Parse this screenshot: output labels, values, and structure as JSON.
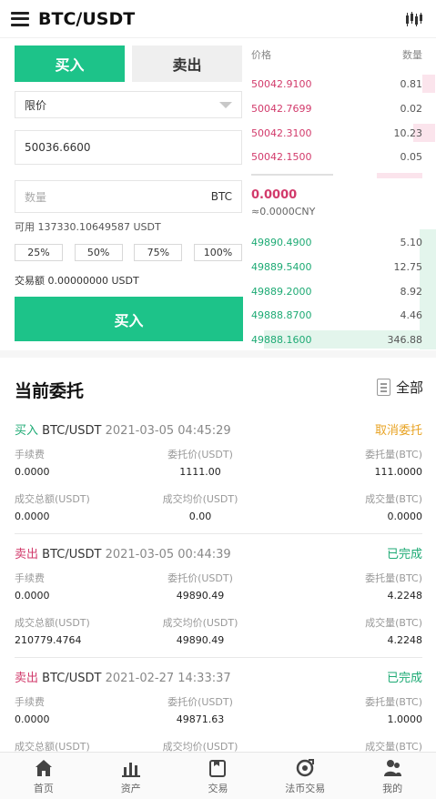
{
  "header": {
    "title": "BTC/USDT",
    "menu_icon": "hamburger-icon",
    "chart_icon": "candlestick-chart-icon"
  },
  "trade": {
    "tab_buy": "买入",
    "tab_sell": "卖出",
    "order_type": "限价",
    "price_value": "50036.6600",
    "amount_placeholder": "数量",
    "amount_unit": "BTC",
    "available": "可用 137330.10649587 USDT",
    "percents": [
      "25%",
      "50%",
      "75%",
      "100%"
    ],
    "turnover": "交易额 0.00000000 USDT",
    "submit_label": "买入"
  },
  "orderbook": {
    "col_price": "价格",
    "col_qty": "数量",
    "asks": [
      {
        "price": "50042.9100",
        "qty": "0.81",
        "depth": 0.07
      },
      {
        "price": "50042.7699",
        "qty": "0.02",
        "depth": 0.0
      },
      {
        "price": "50042.3100",
        "qty": "10.23",
        "depth": 0.12
      },
      {
        "price": "50042.1500",
        "qty": "0.05",
        "depth": 0.0
      }
    ],
    "last_price": "0.0000",
    "last_cny": "≈0.0000CNY",
    "bids": [
      {
        "price": "49890.4900",
        "qty": "5.10",
        "depth": 0.08
      },
      {
        "price": "49889.5400",
        "qty": "12.75",
        "depth": 0.08
      },
      {
        "price": "49889.2000",
        "qty": "8.92",
        "depth": 0.08
      },
      {
        "price": "49888.8700",
        "qty": "4.46",
        "depth": 0.08
      },
      {
        "price": "49888.1600",
        "qty": "346.88",
        "depth": 0.93
      }
    ],
    "colors": {
      "ask": "#d23a6b",
      "bid": "#1daa74"
    }
  },
  "orders": {
    "title": "当前委托",
    "all_label": "全部",
    "labels": {
      "fee": "手续费",
      "entrust_price": "委托价(USDT)",
      "entrust_qty": "委托量(BTC)",
      "deal_total": "成交总额(USDT)",
      "deal_avg": "成交均价(USDT)",
      "deal_qty": "成交量(BTC)"
    },
    "items": [
      {
        "side": "买入",
        "pair": "BTC/USDT",
        "time": "2021-03-05 04:45:29",
        "status": "取消委托",
        "fee": "0.0000",
        "entrust_price": "1111.00",
        "entrust_qty": "111.0000",
        "deal_total": "0.0000",
        "deal_avg": "0.00",
        "deal_qty": "0.0000"
      },
      {
        "side": "卖出",
        "pair": "BTC/USDT",
        "time": "2021-03-05 00:44:39",
        "status": "已完成",
        "fee": "0.0000",
        "entrust_price": "49890.49",
        "entrust_qty": "4.2248",
        "deal_total": "210779.4764",
        "deal_avg": "49890.49",
        "deal_qty": "4.2248"
      },
      {
        "side": "卖出",
        "pair": "BTC/USDT",
        "time": "2021-02-27 14:33:37",
        "status": "已完成",
        "fee": "0.0000",
        "entrust_price": "49871.63",
        "entrust_qty": "1.0000"
      }
    ]
  },
  "nav": [
    {
      "label": "首页",
      "icon": "home-icon"
    },
    {
      "label": "资产",
      "icon": "assets-icon"
    },
    {
      "label": "交易",
      "icon": "trade-icon"
    },
    {
      "label": "法币交易",
      "icon": "fiat-trade-icon"
    },
    {
      "label": "我的",
      "icon": "profile-icon"
    }
  ]
}
